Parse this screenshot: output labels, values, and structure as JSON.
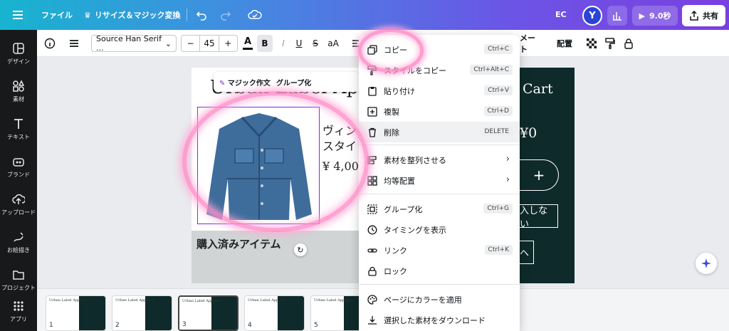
{
  "topbar": {
    "file_label": "ファイル",
    "resize_label": "リサイズ＆マジック変換",
    "ec_label": "EC",
    "avatar_letter": "Y",
    "play_label": "9.0秒",
    "share_label": "共有"
  },
  "sidebar": {
    "items": [
      {
        "label": "デザイン",
        "icon": "layout-icon"
      },
      {
        "label": "素材",
        "icon": "elements-icon"
      },
      {
        "label": "テキスト",
        "icon": "text-icon"
      },
      {
        "label": "ブランド",
        "icon": "brand-icon"
      },
      {
        "label": "アップロード",
        "icon": "upload-icon"
      },
      {
        "label": "お絵描き",
        "icon": "draw-icon"
      },
      {
        "label": "プロジェクト",
        "icon": "folder-icon"
      },
      {
        "label": "アプリ",
        "icon": "apps-icon"
      }
    ]
  },
  "toolbar": {
    "font_name": "Source Han Serif ...",
    "font_size": "45",
    "minus": "−",
    "plus": "+",
    "case_label": "aA",
    "animate_label": "メート",
    "position_label": "配置"
  },
  "canvas": {
    "title": "Urban Label Apparel",
    "product_line1": "ヴィン",
    "product_line2": "スタイ",
    "price": "¥ 4,00",
    "purchased": "購入済みアイテム",
    "magic_edit": "マジック作文",
    "group_label": "グループ化",
    "cart_title": "Cart",
    "cart_total": "¥0",
    "cart_plus": "+",
    "cart_btn2": "入しない",
    "cart_btn3": "ヘ"
  },
  "context_menu": {
    "items": [
      {
        "label": "コピー",
        "shortcut": "Ctrl+C",
        "icon": "copy-icon"
      },
      {
        "label": "スタイルをコピー",
        "shortcut": "Ctrl+Alt+C",
        "icon": "paint-roller-icon"
      },
      {
        "label": "貼り付け",
        "shortcut": "Ctrl+V",
        "icon": "paste-icon"
      },
      {
        "label": "複製",
        "shortcut": "Ctrl+D",
        "icon": "duplicate-icon"
      },
      {
        "label": "削除",
        "shortcut": "DELETE",
        "icon": "trash-icon"
      },
      {
        "label": "素材を整列させる",
        "shortcut": "",
        "icon": "align-icon"
      },
      {
        "label": "均等配置",
        "shortcut": "",
        "icon": "distribute-icon"
      },
      {
        "label": "グループ化",
        "shortcut": "Ctrl+G",
        "icon": "group-icon"
      },
      {
        "label": "タイミングを表示",
        "shortcut": "",
        "icon": "clock-icon"
      },
      {
        "label": "リンク",
        "shortcut": "Ctrl+K",
        "icon": "link-icon"
      },
      {
        "label": "ロック",
        "shortcut": "",
        "icon": "lock-icon"
      },
      {
        "label": "ページにカラーを適用",
        "shortcut": "",
        "icon": "palette-icon"
      },
      {
        "label": "選択した素材をダウンロード",
        "shortcut": "",
        "icon": "download-icon"
      }
    ]
  },
  "filmstrip": {
    "pages": [
      {
        "num": "1",
        "title": "Urban Label Apparel"
      },
      {
        "num": "2",
        "title": "Urban Label Apparel"
      },
      {
        "num": "3",
        "title": "Urban Label Apparel"
      },
      {
        "num": "4",
        "title": "Urban Label Apparel"
      },
      {
        "num": "5",
        "title": "Urban Label Apparel"
      }
    ]
  },
  "colors": {
    "accent": "#7d2ae8",
    "dark_page": "#0f2a2a",
    "highlight": "#ff8cc8"
  }
}
